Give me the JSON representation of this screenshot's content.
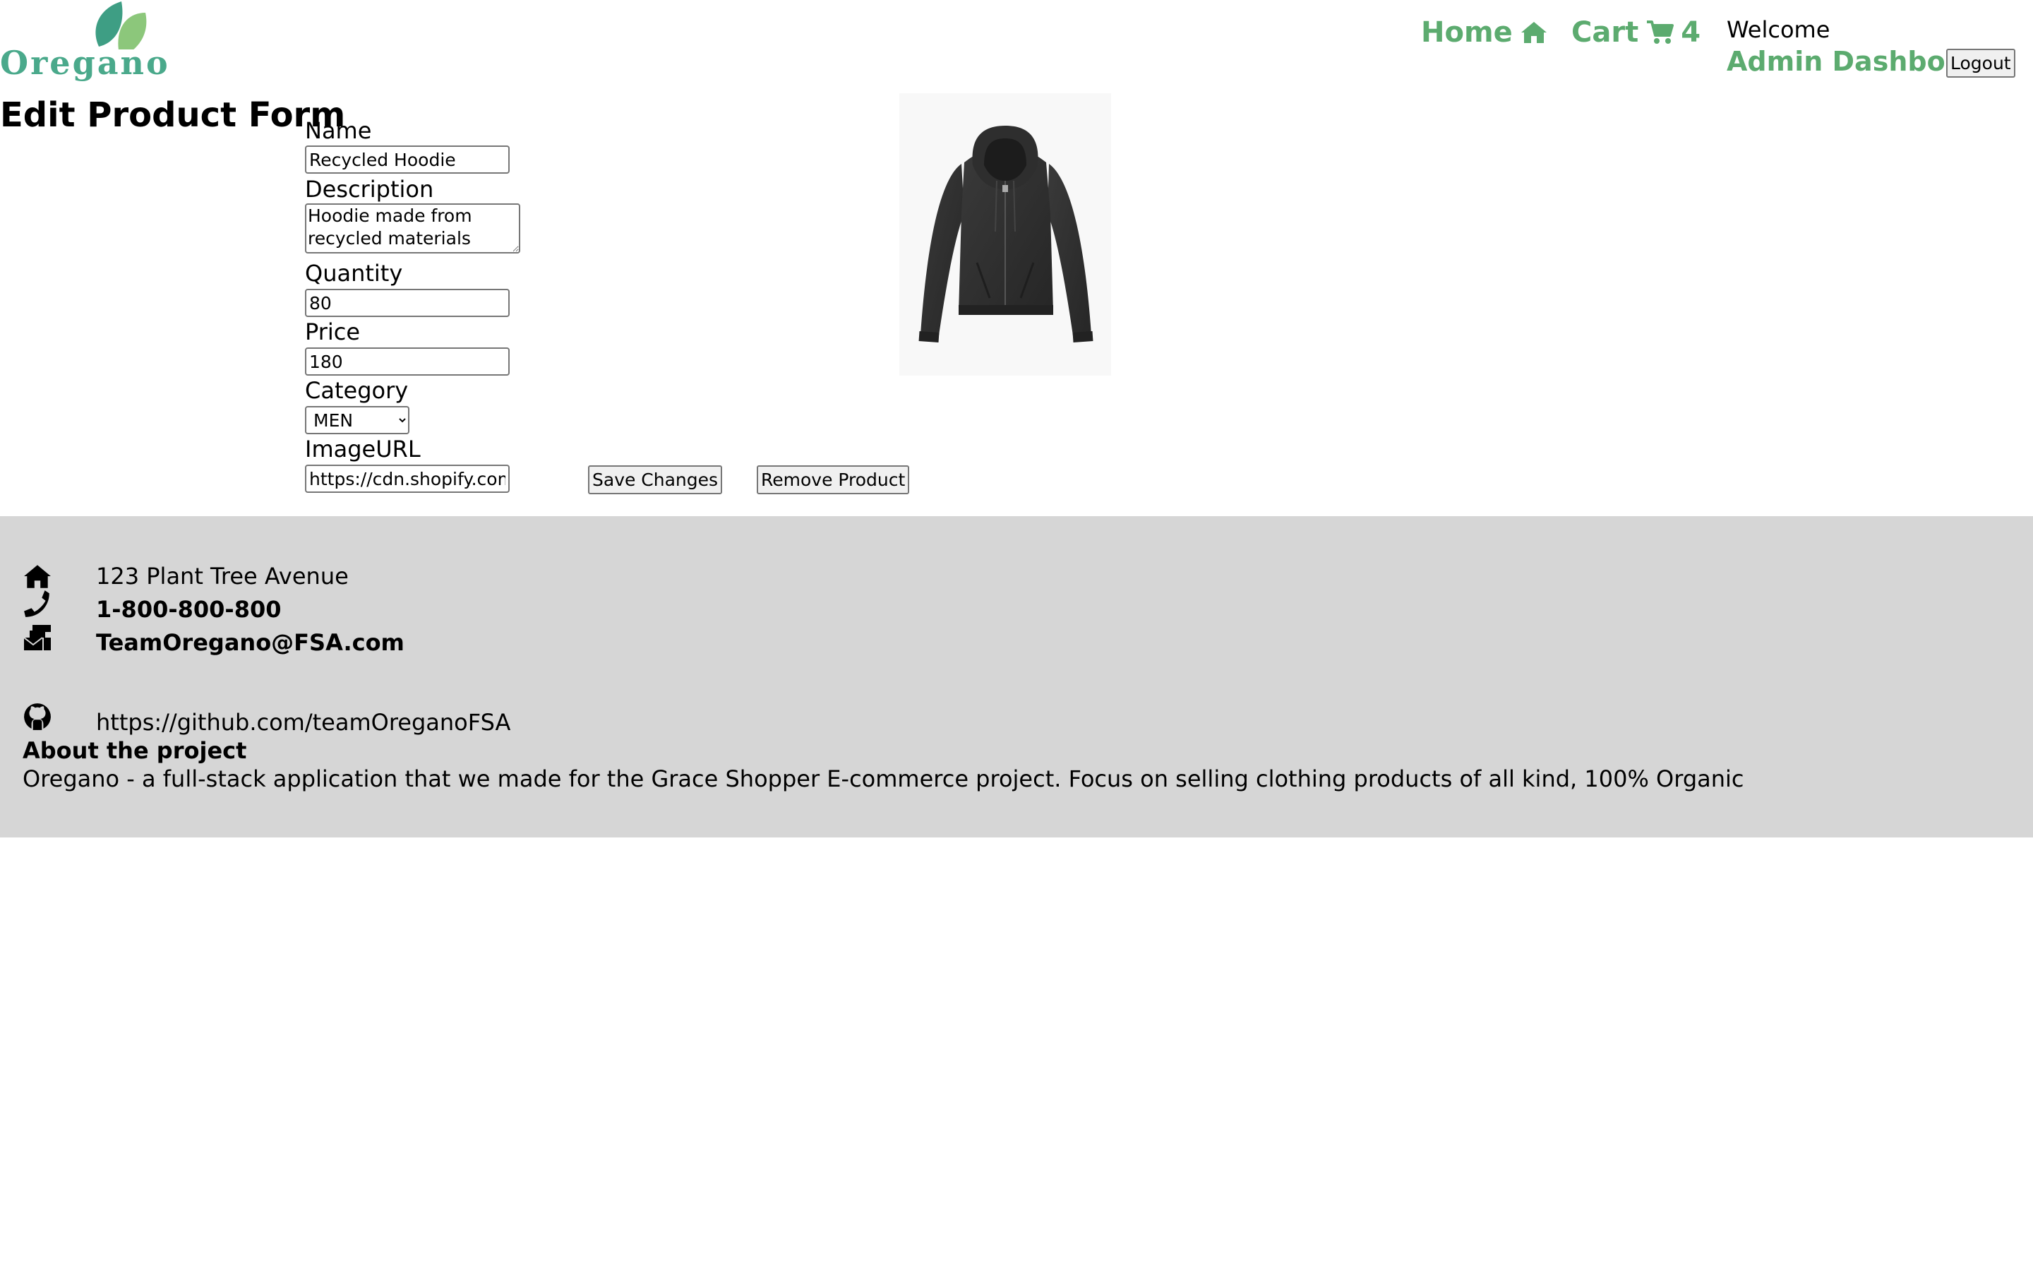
{
  "header": {
    "logo_text": "Oregano",
    "nav_home": "Home",
    "nav_cart": "Cart",
    "cart_count": "4",
    "welcome": "Welcome",
    "admin_link": "Admin Dashboard",
    "logout": "Logout",
    "accent_color": "#5cab6f"
  },
  "form": {
    "title": "Edit Product Form",
    "name_label": "Name",
    "name_value": "Recycled Hoodie",
    "description_label": "Description",
    "description_value": "Hoodie made from recycled materials",
    "quantity_label": "Quantity",
    "quantity_value": "80",
    "price_label": "Price",
    "price_value": "180",
    "category_label": "Category",
    "category_value": "MEN",
    "imageurl_label": "ImageURL",
    "imageurl_value": "https://cdn.shopify.com/",
    "save_button": "Save Changes",
    "remove_button": "Remove Product"
  },
  "footer": {
    "address": "123 Plant Tree Avenue",
    "phone": "1-800-800-800",
    "email": "TeamOregano@FSA.com",
    "github": "https://github.com/teamOreganoFSA",
    "about_title": "About the project",
    "about_text": "Oregano - a full-stack application that we made for the Grace Shopper E-commerce project. Focus on selling clothing products of all kind, 100% Organic",
    "background_color": "#d6d6d6",
    "icons": [
      "home-icon",
      "phone-icon",
      "mail-bulk-icon",
      "github-icon"
    ]
  }
}
